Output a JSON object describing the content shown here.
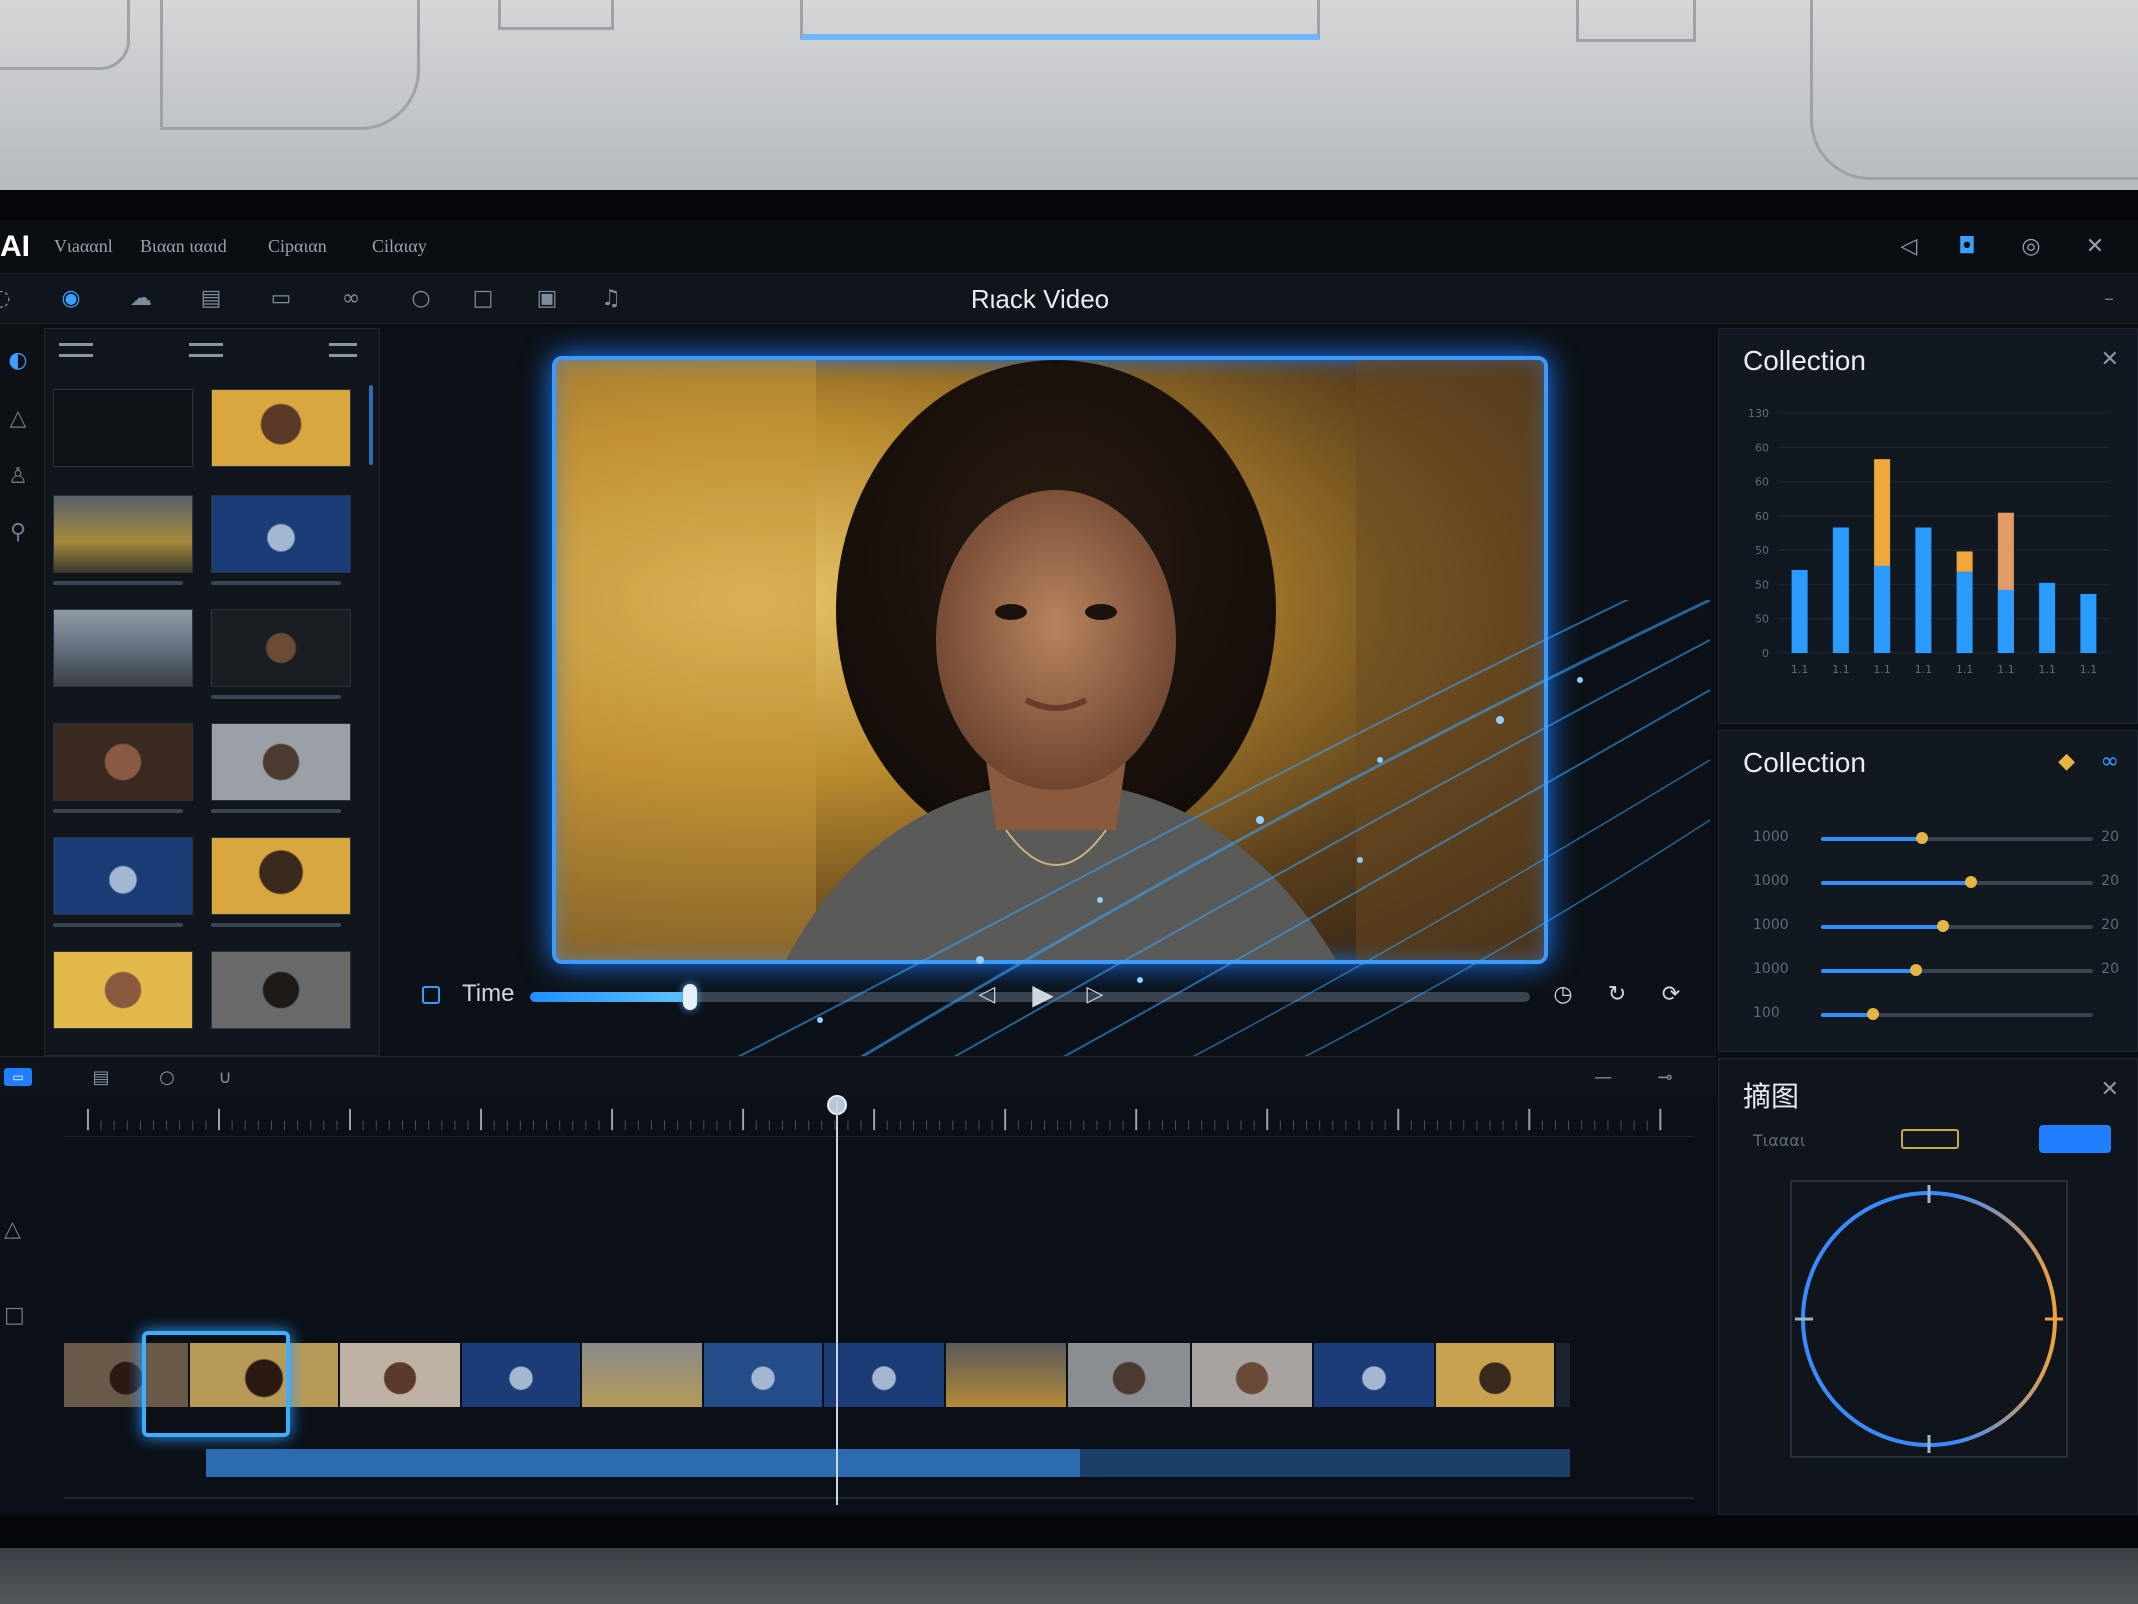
{
  "app": {
    "logo": "AI",
    "title": "Rιack Video",
    "menu": [
      "Vιaααnl",
      "Bιααn ιααιd",
      "Cipαιαn",
      "Cilαιαy"
    ]
  },
  "toolbar": {
    "dash": "–"
  },
  "player": {
    "time_label": "Time",
    "progress": 0.16
  },
  "collection_chart": {
    "title": "Collection",
    "close": "✕"
  },
  "chart_data": {
    "type": "bar",
    "title": "Collection",
    "ylim": [
      0,
      130
    ],
    "yticks": [
      "0",
      "50",
      "50",
      "50",
      "60",
      "60",
      "60",
      "130"
    ],
    "series": [
      {
        "values": [
          45,
          68,
          105,
          68,
          44,
          76,
          38,
          32
        ]
      },
      {
        "values": [
          0,
          0,
          0,
          0,
          22,
          0,
          0,
          0
        ]
      }
    ],
    "colors": [
      "#2a9bff",
      "#f0a83a"
    ],
    "categories": [
      "1.1",
      "1.1",
      "1.1",
      "1.1",
      "1.1",
      "1.1",
      "1.1",
      "1.1"
    ],
    "grid": true
  },
  "collection_sliders": {
    "title": "Collection",
    "rows": [
      {
        "label": "1000",
        "value": 0.37,
        "end": "20"
      },
      {
        "label": "1000",
        "value": 0.55,
        "end": "20"
      },
      {
        "label": "1000",
        "value": 0.45,
        "end": "20"
      },
      {
        "label": "1000",
        "value": 0.35,
        "end": "20"
      },
      {
        "label": "100",
        "value": 0.19,
        "end": ""
      }
    ]
  },
  "color_panel": {
    "title": "摘图",
    "label": "Tιαααι",
    "close": "✕"
  },
  "colors": {
    "accent": "#3c9bff",
    "panel": "#121820",
    "highlight": "#e7b544"
  }
}
